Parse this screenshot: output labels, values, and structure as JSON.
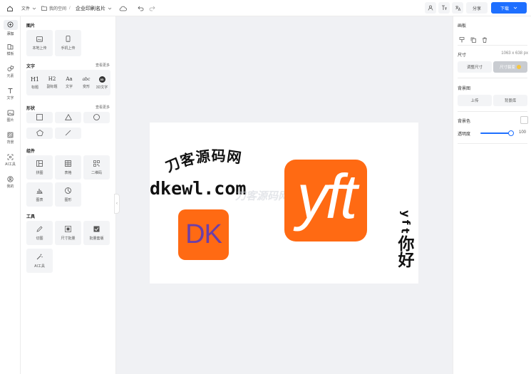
{
  "topbar": {
    "file_menu": "文件",
    "breadcrumb_space": "我的空间",
    "separator": "/",
    "doc_title": "企业印刷名片",
    "share_label": "分享",
    "download_label": "下载"
  },
  "rail": {
    "items": [
      {
        "label": "添加",
        "icon": "plus-circle-icon"
      },
      {
        "label": "模板",
        "icon": "template-icon"
      },
      {
        "label": "元素",
        "icon": "shapes-icon"
      },
      {
        "label": "文字",
        "icon": "text-icon"
      },
      {
        "label": "图片",
        "icon": "image-icon"
      },
      {
        "label": "背景",
        "icon": "background-icon"
      },
      {
        "label": "AI工具",
        "icon": "ai-scan-icon"
      },
      {
        "label": "我的",
        "icon": "user-icon"
      }
    ]
  },
  "panel": {
    "images": {
      "title": "图片",
      "items": [
        "本地上传",
        "手机上传"
      ]
    },
    "text": {
      "title": "文字",
      "more": "查看更多",
      "items": [
        {
          "glyph": "H1",
          "label": "标题"
        },
        {
          "glyph": "H2",
          "label": "副标题"
        },
        {
          "glyph": "Aa",
          "label": "文字"
        },
        {
          "glyph": "abc",
          "label": "变形"
        },
        {
          "glyph": "3D",
          "label": "3D文字"
        }
      ]
    },
    "shapes": {
      "title": "形状",
      "more": "查看更多"
    },
    "components": {
      "title": "组件",
      "items": [
        "拼图",
        "表格",
        "二维码",
        "图表",
        "图形"
      ]
    },
    "tools": {
      "title": "工具",
      "items": [
        "切图",
        "尺寸批量",
        "批量套版",
        "AI工具"
      ]
    }
  },
  "canvas": {
    "curved_text": "刀客源码网",
    "domain_text": "dkewl.com",
    "logo_dk": "DK",
    "logo_yft": "yft",
    "watermark": "刀客源码网",
    "vertical_text": [
      "y",
      "f",
      "t",
      "你",
      "好"
    ],
    "colors": {
      "orange": "#ff6a13",
      "dk_text": "#6c3fa8"
    }
  },
  "right_panel": {
    "artboard_label": "画板",
    "size_label": "尺寸",
    "size_value": "1063 x 638 px",
    "adjust_size": "调整尺寸",
    "resize_batch": "尺寸裂变",
    "bg_image_label": "背景图",
    "upload": "上传",
    "bg_library": "背景库",
    "bg_color_label": "背景色",
    "opacity_label": "透明度",
    "opacity_value": "100",
    "accent": "#1e6fff"
  }
}
